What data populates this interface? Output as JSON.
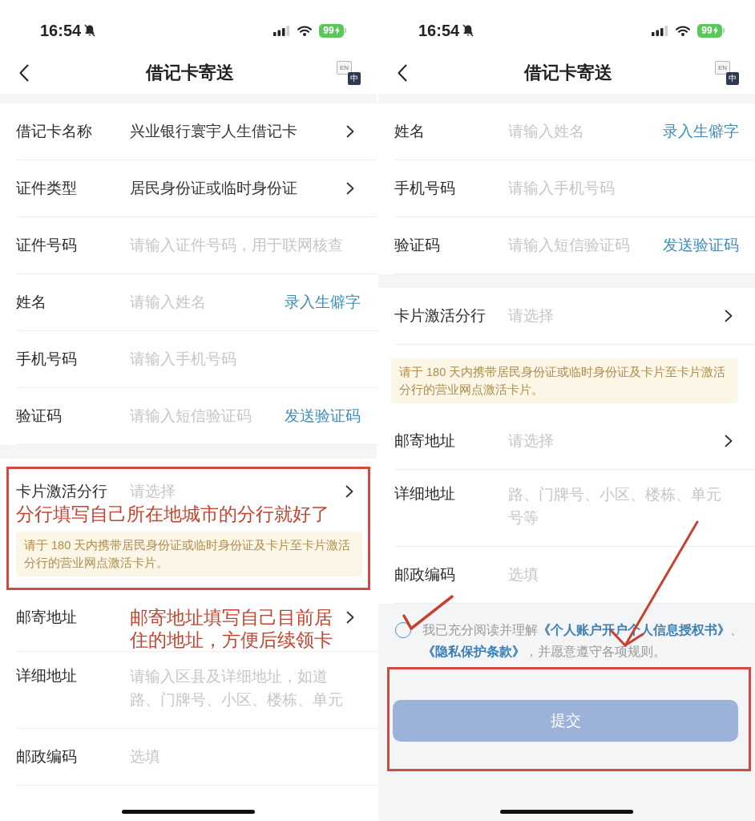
{
  "phones": [
    {
      "status_bar": {
        "time": "16:54",
        "muted": true,
        "battery": "99"
      },
      "nav": {
        "title": "借记卡寄送",
        "language_switch": {
          "from": "EN",
          "to": "中"
        }
      },
      "groups": [
        {
          "blocks": [
            {
              "highlighted": false,
              "items": [
                {
                  "kind": "select",
                  "label": "借记卡名称",
                  "value": "兴业银行寰宇人生借记卡"
                },
                {
                  "kind": "select",
                  "label": "证件类型",
                  "value": "居民身份证或临时身份证"
                },
                {
                  "kind": "input",
                  "label": "证件号码",
                  "placeholder": "请输入证件号码，用于联网核查"
                },
                {
                  "kind": "input",
                  "label": "姓名",
                  "placeholder": "请输入姓名",
                  "action": "录入生僻字"
                },
                {
                  "kind": "input",
                  "label": "手机号码",
                  "placeholder": "请输入手机号码"
                },
                {
                  "kind": "input",
                  "label": "验证码",
                  "placeholder": "请输入短信验证码",
                  "action": "发送验证码"
                }
              ]
            }
          ]
        },
        {
          "blocks": [
            {
              "highlighted": true,
              "items": [
                {
                  "kind": "select",
                  "label": "卡片激活分行",
                  "placeholder": "请选择"
                },
                {
                  "kind": "remark",
                  "text": "分行填写自己所在地城市的分行就好了"
                },
                {
                  "kind": "notice",
                  "text": "请于 180 天内携带居民身份证或临时身份证及卡片至卡片激活分行的营业网点激活卡片。"
                }
              ]
            },
            {
              "highlighted": false,
              "items": [
                {
                  "kind": "select",
                  "label": "邮寄地址",
                  "remark": "邮寄地址填写自己目前居住的地址，方便后续领卡"
                },
                {
                  "kind": "textarea",
                  "label": "详细地址",
                  "placeholder": "请输入区县及详细地址，如道路、门牌号、小区、楼栋、单元"
                },
                {
                  "kind": "input",
                  "label": "邮政编码",
                  "placeholder": "选填"
                }
              ]
            }
          ]
        }
      ]
    },
    {
      "status_bar": {
        "time": "16:54",
        "muted": true,
        "battery": "99"
      },
      "nav": {
        "title": "借记卡寄送",
        "language_switch": {
          "from": "EN",
          "to": "中"
        }
      },
      "groups": [
        {
          "blocks": [
            {
              "highlighted": false,
              "items": [
                {
                  "kind": "input",
                  "label": "姓名",
                  "placeholder": "请输入姓名",
                  "action": "录入生僻字"
                },
                {
                  "kind": "input",
                  "label": "手机号码",
                  "placeholder": "请输入手机号码"
                },
                {
                  "kind": "input",
                  "label": "验证码",
                  "placeholder": "请输入短信验证码",
                  "action": "发送验证码"
                }
              ]
            }
          ]
        },
        {
          "blocks": [
            {
              "highlighted": false,
              "items": [
                {
                  "kind": "select",
                  "label": "卡片激活分行",
                  "placeholder": "请选择"
                },
                {
                  "kind": "notice",
                  "text": "请于 180 天内携带居民身份证或临时身份证及卡片至卡片激活分行的营业网点激活卡片。"
                },
                {
                  "kind": "select",
                  "label": "邮寄地址",
                  "placeholder": "请选择"
                },
                {
                  "kind": "textarea",
                  "label": "详细地址",
                  "placeholder": "路、门牌号、小区、楼栋、单元号等"
                },
                {
                  "kind": "input",
                  "label": "邮政编码",
                  "placeholder": "选填"
                }
              ]
            }
          ]
        }
      ],
      "footer": {
        "agreement": {
          "checked": false,
          "segments": [
            {
              "text": "我已充分阅读并理解",
              "link": false
            },
            {
              "text": "《个人账户开户个人信息授权书》",
              "link": true
            },
            {
              "text": "、",
              "link": false
            },
            {
              "text": "《隐私保护条款》",
              "link": true
            },
            {
              "text": "，并愿意遵守各项规则。",
              "link": false
            }
          ],
          "annotation_tick": true,
          "annotation_arrow": true
        },
        "submit": {
          "label": "提交",
          "disabled": true,
          "highlighted": true
        }
      }
    }
  ]
}
